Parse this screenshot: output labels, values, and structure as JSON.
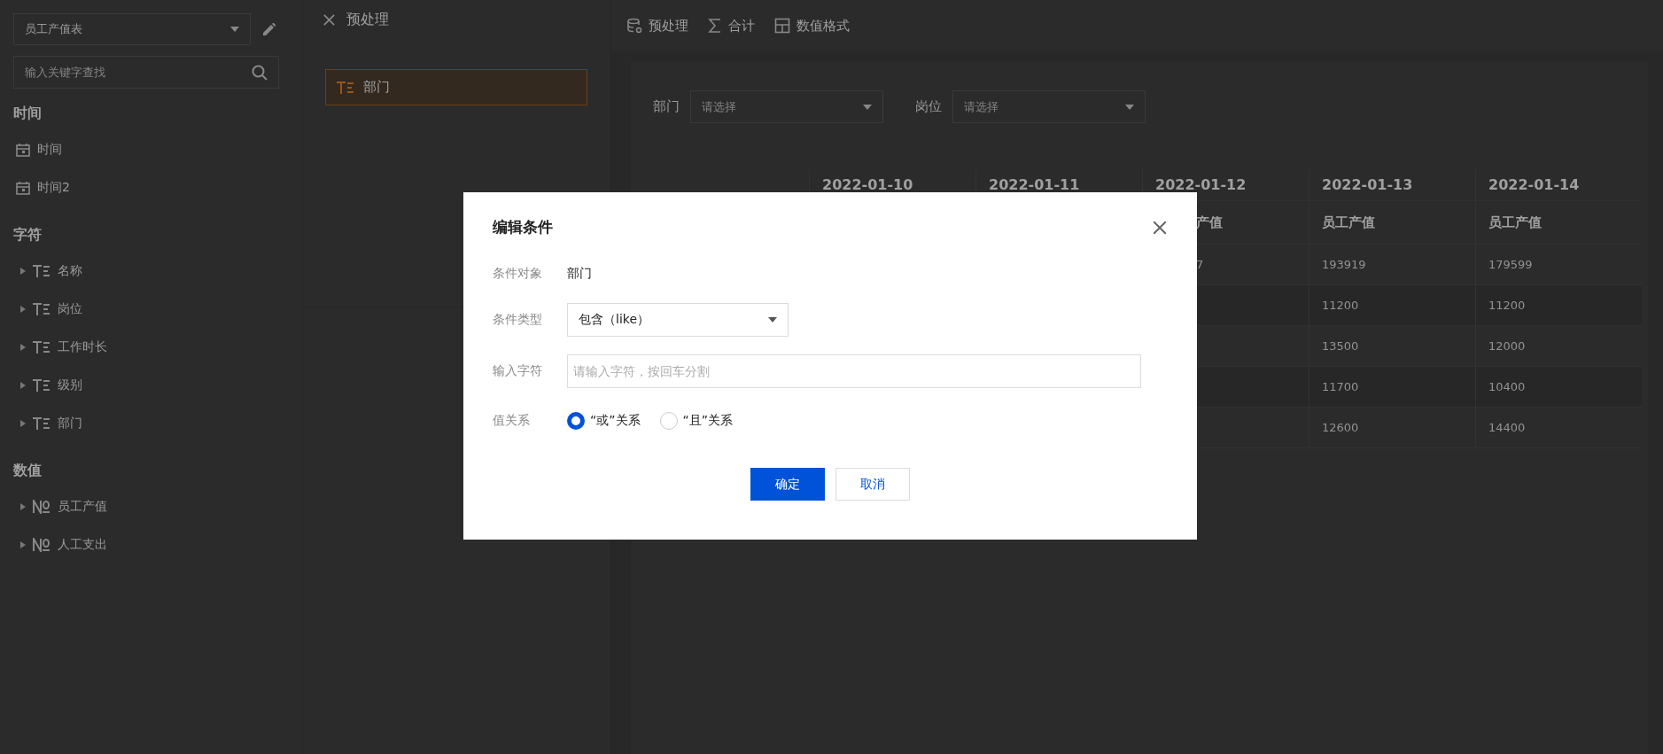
{
  "sidebar": {
    "dataset_select": {
      "value": "员工产值表"
    },
    "search": {
      "placeholder": "输入关键字查找"
    },
    "groups": [
      {
        "title": "时间",
        "items": [
          {
            "kind": "date",
            "label": "时间",
            "expandable": false
          },
          {
            "kind": "date",
            "label": "时间2",
            "expandable": false
          }
        ]
      },
      {
        "title": "字符",
        "items": [
          {
            "kind": "text",
            "label": "名称",
            "expandable": true
          },
          {
            "kind": "text",
            "label": "岗位",
            "expandable": true
          },
          {
            "kind": "text",
            "label": "工作时长",
            "expandable": true
          },
          {
            "kind": "text",
            "label": "级别",
            "expandable": true
          },
          {
            "kind": "text",
            "label": "部门",
            "expandable": true
          }
        ]
      },
      {
        "title": "数值",
        "items": [
          {
            "kind": "number",
            "label": "员工产值",
            "expandable": true
          },
          {
            "kind": "number",
            "label": "人工支出",
            "expandable": true
          }
        ]
      }
    ]
  },
  "preprocess_panel": {
    "title": "预处理",
    "fields": [
      {
        "kind": "text",
        "label": "部门"
      }
    ]
  },
  "toolbar": [
    {
      "kind": "preprocess",
      "label": "预处理"
    },
    {
      "kind": "sum",
      "label": "合计"
    },
    {
      "kind": "format",
      "label": "数值格式"
    }
  ],
  "filters": [
    {
      "label": "部门",
      "placeholder": "请选择"
    },
    {
      "label": "岗位",
      "placeholder": "请选择"
    }
  ],
  "table": {
    "columns": [
      "2022-01-10",
      "2022-01-11",
      "2022-01-12",
      "2022-01-13",
      "2022-01-14"
    ],
    "subheader": {
      "column_3": "产值",
      "column_4": "员工产值",
      "column_5": "员工产值"
    },
    "rows": [
      {
        "column_3": "7",
        "column_4": "193919",
        "column_5": "179599"
      },
      {
        "column_4": "11200",
        "column_5": "11200"
      },
      {
        "column_4": "13500",
        "column_5": "12000"
      },
      {
        "column_4": "11700",
        "column_5": "10400"
      },
      {
        "column_4": "12600",
        "column_5": "14400"
      }
    ]
  },
  "dialog": {
    "title": "编辑条件",
    "fields": [
      {
        "kind": "static",
        "label": "条件对象",
        "value": "部门"
      },
      {
        "kind": "select",
        "label": "条件类型",
        "value": "包含（like）"
      },
      {
        "kind": "input",
        "label": "输入字符",
        "placeholder": "请输入字符，按回车分割"
      },
      {
        "kind": "radio",
        "label": "值关系",
        "options": [
          {
            "label": "“或”关系",
            "selected": true
          },
          {
            "label": "“且”关系",
            "selected": false
          }
        ]
      }
    ],
    "buttons": [
      {
        "kind": "primary",
        "label": "确定"
      },
      {
        "kind": "secondary",
        "label": "取消"
      }
    ]
  }
}
